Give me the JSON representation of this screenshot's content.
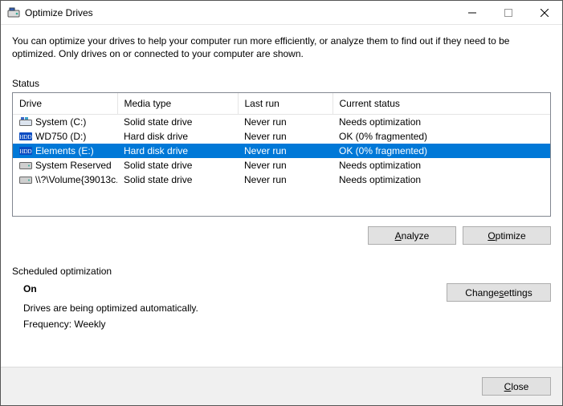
{
  "window": {
    "title": "Optimize Drives"
  },
  "intro": "You can optimize your drives to help your computer run more efficiently, or analyze them to find out if they need to be optimized. Only drives on or connected to your computer are shown.",
  "status_label": "Status",
  "columns": {
    "drive": "Drive",
    "media": "Media type",
    "last": "Last run",
    "status": "Current status"
  },
  "rows": [
    {
      "icon": "os",
      "drive": "System (C:)",
      "media": "Solid state drive",
      "last": "Never run",
      "status": "Needs optimization",
      "selected": false
    },
    {
      "icon": "hdd",
      "drive": "WD750 (D:)",
      "media": "Hard disk drive",
      "last": "Never run",
      "status": "OK (0% fragmented)",
      "selected": false
    },
    {
      "icon": "hdd",
      "drive": "Elements (E:)",
      "media": "Hard disk drive",
      "last": "Never run",
      "status": "OK (0% fragmented)",
      "selected": true
    },
    {
      "icon": "drv",
      "drive": "System Reserved",
      "media": "Solid state drive",
      "last": "Never run",
      "status": "Needs optimization",
      "selected": false
    },
    {
      "icon": "drv",
      "drive": "\\\\?\\Volume{39013c...",
      "media": "Solid state drive",
      "last": "Never run",
      "status": "Needs optimization",
      "selected": false
    }
  ],
  "buttons": {
    "analyze": {
      "pre": "",
      "u": "A",
      "post": "nalyze"
    },
    "optimize": {
      "pre": "",
      "u": "O",
      "post": "ptimize"
    },
    "change": {
      "pre": "Change ",
      "u": "s",
      "post": "ettings"
    },
    "close": {
      "pre": "",
      "u": "C",
      "post": "lose"
    }
  },
  "schedule": {
    "label": "Scheduled optimization",
    "state": "On",
    "desc": "Drives are being optimized automatically.",
    "freq": "Frequency: Weekly"
  }
}
